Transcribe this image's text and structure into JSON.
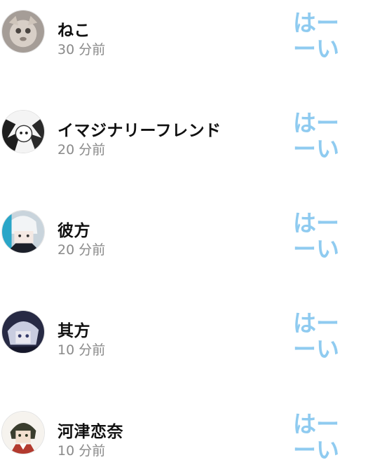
{
  "comments": [
    {
      "name": "ねこ",
      "time": "30 分前",
      "reply_line1": "はー",
      "reply_line2": "ーい",
      "avatar_icon": "cat-avatar-icon"
    },
    {
      "name": "イマジナリーフレンド",
      "time": "20 分前",
      "reply_line1": "はー",
      "reply_line2": "ーい",
      "avatar_icon": "manga-avatar-icon"
    },
    {
      "name": "彼方",
      "time": "20 分前",
      "reply_line1": "はー",
      "reply_line2": "ーい",
      "avatar_icon": "anime-boy-avatar-icon"
    },
    {
      "name": "其方",
      "time": "10 分前",
      "reply_line1": "はー",
      "reply_line2": "ーい",
      "avatar_icon": "dark-anime-avatar-icon"
    },
    {
      "name": "河津恋奈",
      "time": "10 分前",
      "reply_line1": "はー",
      "reply_line2": "ーい",
      "avatar_icon": "anime-girl-avatar-icon"
    }
  ],
  "colors": {
    "reply": "#8fcbf0",
    "name": "#111111",
    "time": "#8a8a8a"
  }
}
